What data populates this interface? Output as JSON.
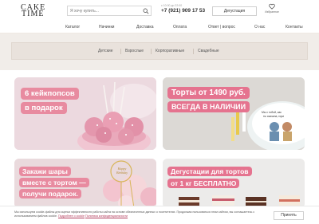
{
  "brand": {
    "line1": "CAKE",
    "line2": "TIME"
  },
  "search": {
    "placeholder": "Я хочу купить..."
  },
  "contact": {
    "caption": "с 10:00 до 22:00",
    "phone": "+7 (921) 909 17 53"
  },
  "header": {
    "tasting_button": "Дегустация",
    "favorites_label": "Избранное"
  },
  "nav": [
    "Каталог",
    "Начинки",
    "Доставка",
    "Оплата",
    "Ответ | вопрос",
    "О нас",
    "Контакты"
  ],
  "categories": [
    "Детские",
    "Взрослые",
    "Корпоративные",
    "Свадебные"
  ],
  "banners": {
    "b1": {
      "line1": "6 кейкпопсов",
      "line2": "в подарок"
    },
    "b2": {
      "line1": "Торты от 1490 руб.",
      "line2": "ВСЕГДА В НАЛИЧИИ",
      "topper_line1": "Мы с тобой, как",
      "topper_line2": "ты сказала, гори"
    },
    "b3": {
      "line1": "Закажи шары",
      "line2": "вместе с тортом —",
      "line3": "получи подарок.",
      "topper": "Happy Birthday"
    },
    "b4": {
      "line1": "Дегустации для тортов",
      "line2": "от 1 кг БЕСПЛАТНО"
    }
  },
  "cookie": {
    "text": "Мы используем cookie-файлы для оценки эффективности работы сайта на основе обезличенных данных о посетителях. Продолжая пользоваться этим сайтом, вы соглашаетесь с использованием файлов cookie.",
    "link1": "Подробнее о cookie",
    "link2": "Политика конфиденциальности",
    "button": "Принять"
  },
  "colors": {
    "accent_pink": "#e88ba0",
    "band_beige": "#f1ede9"
  }
}
